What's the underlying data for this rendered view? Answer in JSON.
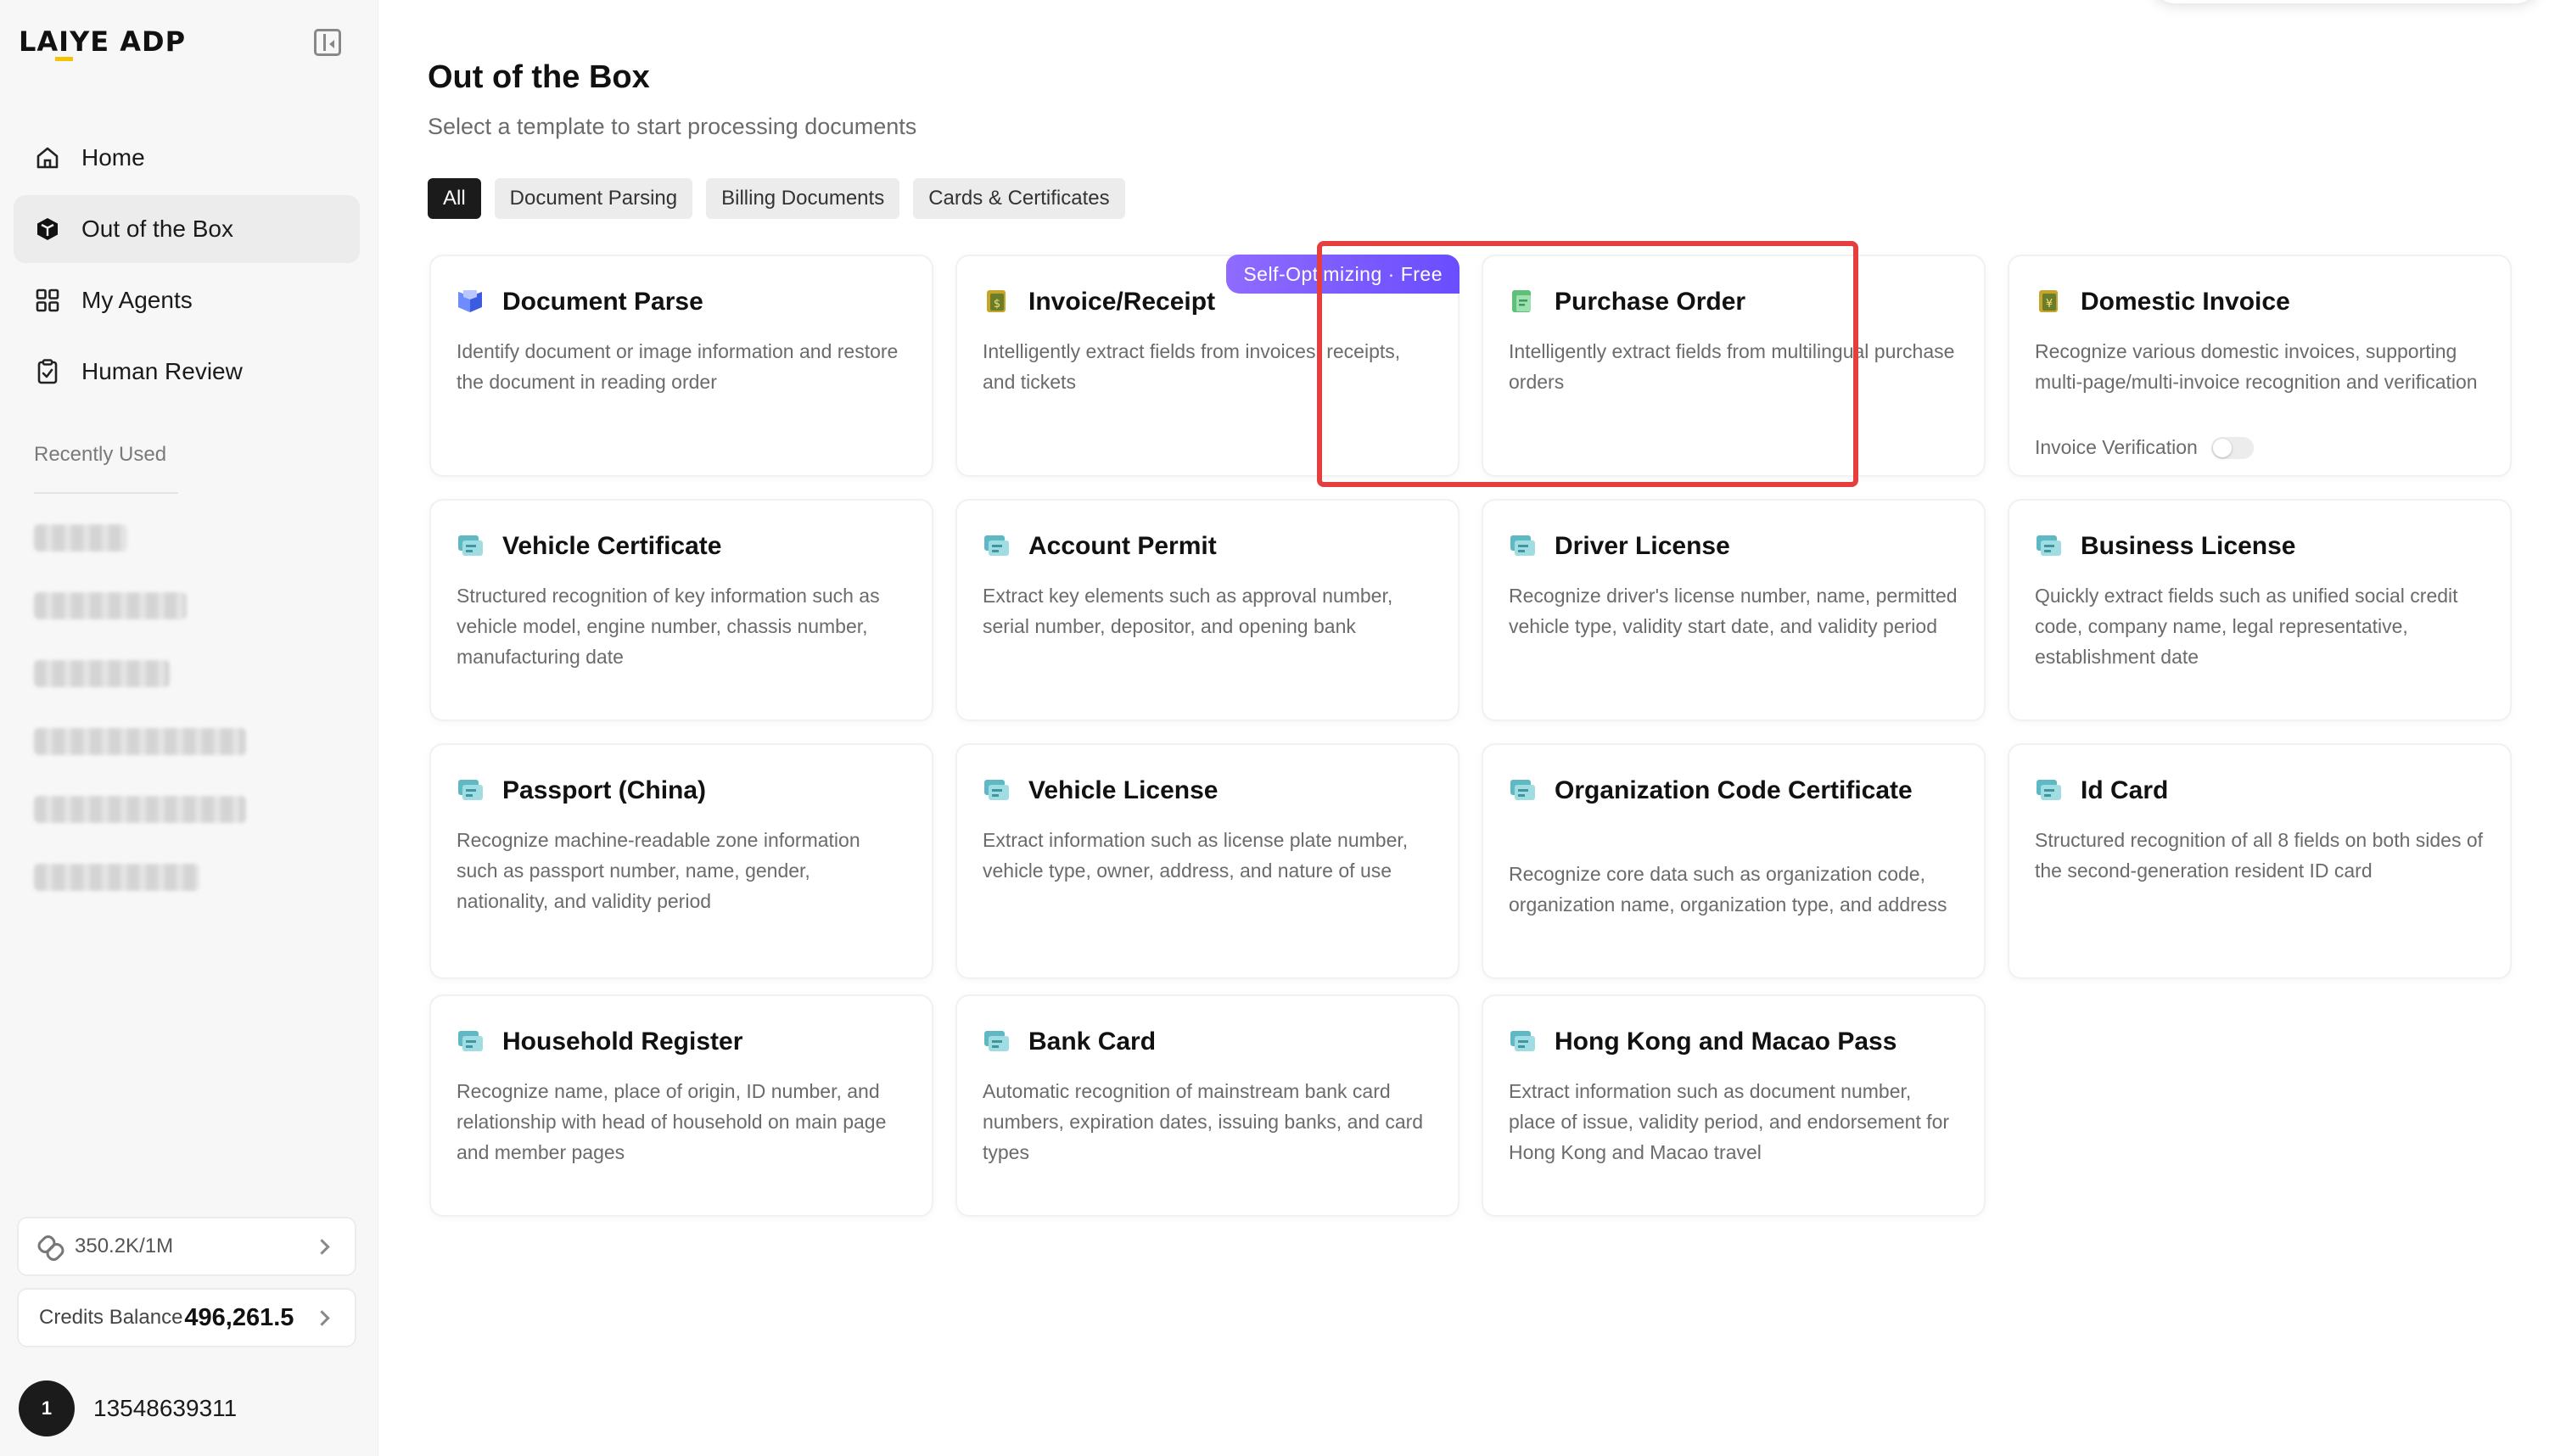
{
  "app": {
    "brand_prefix": "LA",
    "brand_i": "I",
    "brand_suffix": "YE",
    "brand_product": "ADP"
  },
  "sidebar": {
    "nav": [
      {
        "label": "Home",
        "icon": "home-icon"
      },
      {
        "label": "Out of the Box",
        "icon": "box-icon",
        "active": true
      },
      {
        "label": "My Agents",
        "icon": "grid-icon"
      },
      {
        "label": "Human Review",
        "icon": "clipboard-check-icon"
      }
    ],
    "recent_title": "Recently Used",
    "quota": "350.2K/1M",
    "credits_label": "Credits Balance",
    "credits_value": "496,261.5",
    "user_avatar": "1",
    "user_name": "13548639311"
  },
  "main": {
    "title": "Out of the Box",
    "subtitle": "Select a template to start processing documents",
    "filters": [
      "All",
      "Document Parsing",
      "Billing Documents",
      "Cards & Certificates"
    ],
    "active_filter": "All",
    "cards": [
      {
        "title": "Document Parse",
        "desc": "Identify document or image information and restore the document in reading order",
        "icon": "document-parse-icon"
      },
      {
        "title": "Invoice/Receipt",
        "desc": "Intelligently extract fields from invoices, receipts, and tickets",
        "icon": "invoice-icon",
        "badge": "Self-Optimizing · Free",
        "highlighted": true
      },
      {
        "title": "Purchase Order",
        "desc": "Intelligently extract fields from multilingual purchase orders",
        "icon": "purchase-order-icon"
      },
      {
        "title": "Domestic Invoice",
        "desc": "Recognize various domestic invoices, supporting multi-page/multi-invoice recognition and verification",
        "icon": "domestic-invoice-icon",
        "toggle_label": "Invoice Verification",
        "toggle_on": false
      },
      {
        "title": "Vehicle Certificate",
        "desc": "Structured recognition of key information such as vehicle model, engine number, chassis number, manufacturing date",
        "icon": "card-icon"
      },
      {
        "title": "Account Permit",
        "desc": "Extract key elements such as approval number, serial number, depositor, and opening bank",
        "icon": "card-icon"
      },
      {
        "title": "Driver License",
        "desc": "Recognize driver's license number, name, permitted vehicle type, validity start date, and validity period",
        "icon": "card-icon"
      },
      {
        "title": "Business License",
        "desc": "Quickly extract fields such as unified social credit code, company name, legal representative, establishment date",
        "icon": "card-icon"
      },
      {
        "title": "Passport (China)",
        "desc": "Recognize machine-readable zone information such as passport number, name, gender, nationality, and validity period",
        "icon": "card-icon"
      },
      {
        "title": "Vehicle License",
        "desc": "Extract information such as license plate number, vehicle type, owner, address, and nature of use",
        "icon": "card-icon"
      },
      {
        "title": "Organization Code Certificate",
        "desc": "Recognize core data such as organization code, organization name, organization type, and address",
        "icon": "card-icon"
      },
      {
        "title": "Id Card",
        "desc": "Structured recognition of all 8 fields on both sides of the second-generation resident ID card",
        "icon": "card-icon"
      },
      {
        "title": "Household Register",
        "desc": "Recognize name, place of origin, ID number, and relationship with head of household on main page and member pages",
        "icon": "card-icon"
      },
      {
        "title": "Bank Card",
        "desc": "Automatic recognition of mainstream bank card numbers, expiration dates, issuing banks, and card types",
        "icon": "card-icon"
      },
      {
        "title": "Hong Kong and Macao Pass",
        "desc": "Extract information such as document number, place of issue, validity period, and endorsement for Hong Kong and Macao travel",
        "icon": "card-icon"
      }
    ]
  },
  "colors": {
    "highlight": "#e53e3e",
    "badge": "#7c5cff",
    "card_icon": "#4fb3bf",
    "accent": "#f5c400"
  }
}
